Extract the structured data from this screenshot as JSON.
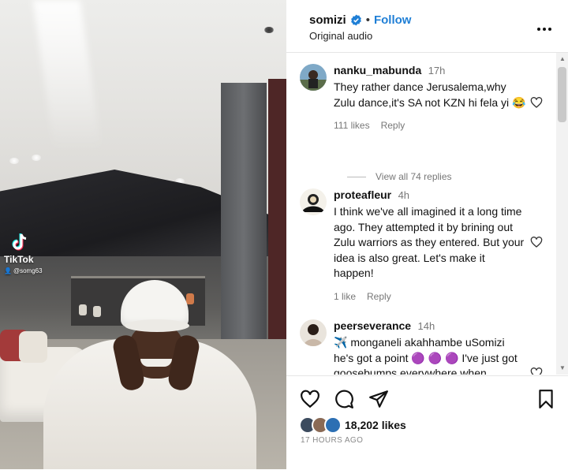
{
  "video": {
    "watermark_label": "TikTok",
    "watermark_user": "@somg63"
  },
  "post": {
    "username": "somizi",
    "follow_label": "Follow",
    "separator": "•",
    "audio": "Original audio",
    "more_icon": "more-dots-icon",
    "likes": "18,202 likes",
    "time_ago": "17 HOURS AGO"
  },
  "comments": [
    {
      "user": "nanku_mabunda",
      "time": "17h",
      "text": "They rather dance Jerusalema,why Zulu dance,it's SA not KZN hi fela yi 😂",
      "likes": "111 likes",
      "reply": "Reply",
      "view_replies": "View all 74 replies"
    },
    {
      "user": "proteafleur",
      "time": "4h",
      "text": "I think we've all imagined it a long time ago. They attempted it by brining out Zulu warriors as they entered. But your idea is also great. Let's make it happen!",
      "likes": "1 like",
      "reply": "Reply"
    },
    {
      "user": "peerseverance",
      "time": "14h",
      "text": "✈️ monganeli akahhambe uSomizi he's got a point 🟣 🟣 🟣 I've just got goosebumps everywhere when",
      "likes": "",
      "reply": ""
    }
  ],
  "colors": {
    "follow": "#1f7fd6",
    "verified": "#1f7fd6",
    "muted": "#777777"
  }
}
